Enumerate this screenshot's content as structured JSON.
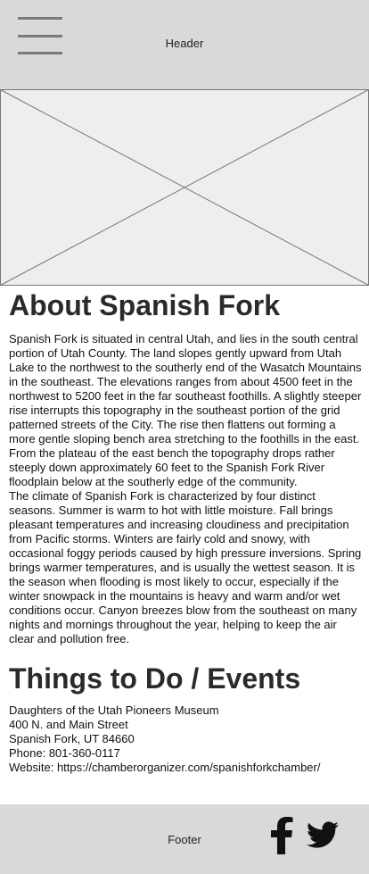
{
  "header": {
    "title": "Header",
    "menu_icon": "hamburger-menu-icon"
  },
  "hero": {
    "icon": "image-placeholder-icon"
  },
  "about": {
    "title": "About Spanish Fork",
    "paragraph_1": "Spanish Fork is situated in central Utah, and lies in the south central portion of Utah County. The land slopes gently upward from Utah Lake to the northwest to the southerly end of the Wasatch Mountains in the southeast. The elevations ranges from about 4500 feet in the northwest to 5200 feet in the far southeast foothills. A slightly steeper rise interrupts this topography in the southeast portion of the grid patterned streets of the City. The rise then flattens out forming a more gentle sloping bench area stretching to the foothills in the east. From the plateau of the east bench the topography drops rather steeply down approximately 60 feet to the Spanish Fork River floodplain below at the southerly edge of the community.",
    "paragraph_2": "The climate of Spanish Fork is characterized by four distinct seasons. Summer is warm to hot with little moisture. Fall brings pleasant temperatures and increasing cloudiness and precipitation from Pacific storms. Winters are fairly cold and snowy, with occasional foggy periods caused by high pressure inversions. Spring brings warmer temperatures, and is usually the wettest season. It is the season when flooding is most likely to occur, especially if the winter snowpack in the mountains is heavy and warm and/or wet conditions occur. Canyon breezes blow from the southeast on many nights and mornings throughout the year, helping to keep the air clear and pollution free."
  },
  "events": {
    "title": "Things to Do / Events",
    "items": [
      {
        "name": "Daughters of the Utah Pioneers Museum",
        "address": "400 N. and Main Street",
        "city": "Spanish Fork, UT 84660",
        "phone": "Phone: 801-360-0117",
        "website": "Website: https://chamberorganizer.com/spanishforkchamber/"
      }
    ]
  },
  "footer": {
    "text": "Footer",
    "icons": [
      "facebook-icon",
      "twitter-icon"
    ]
  }
}
